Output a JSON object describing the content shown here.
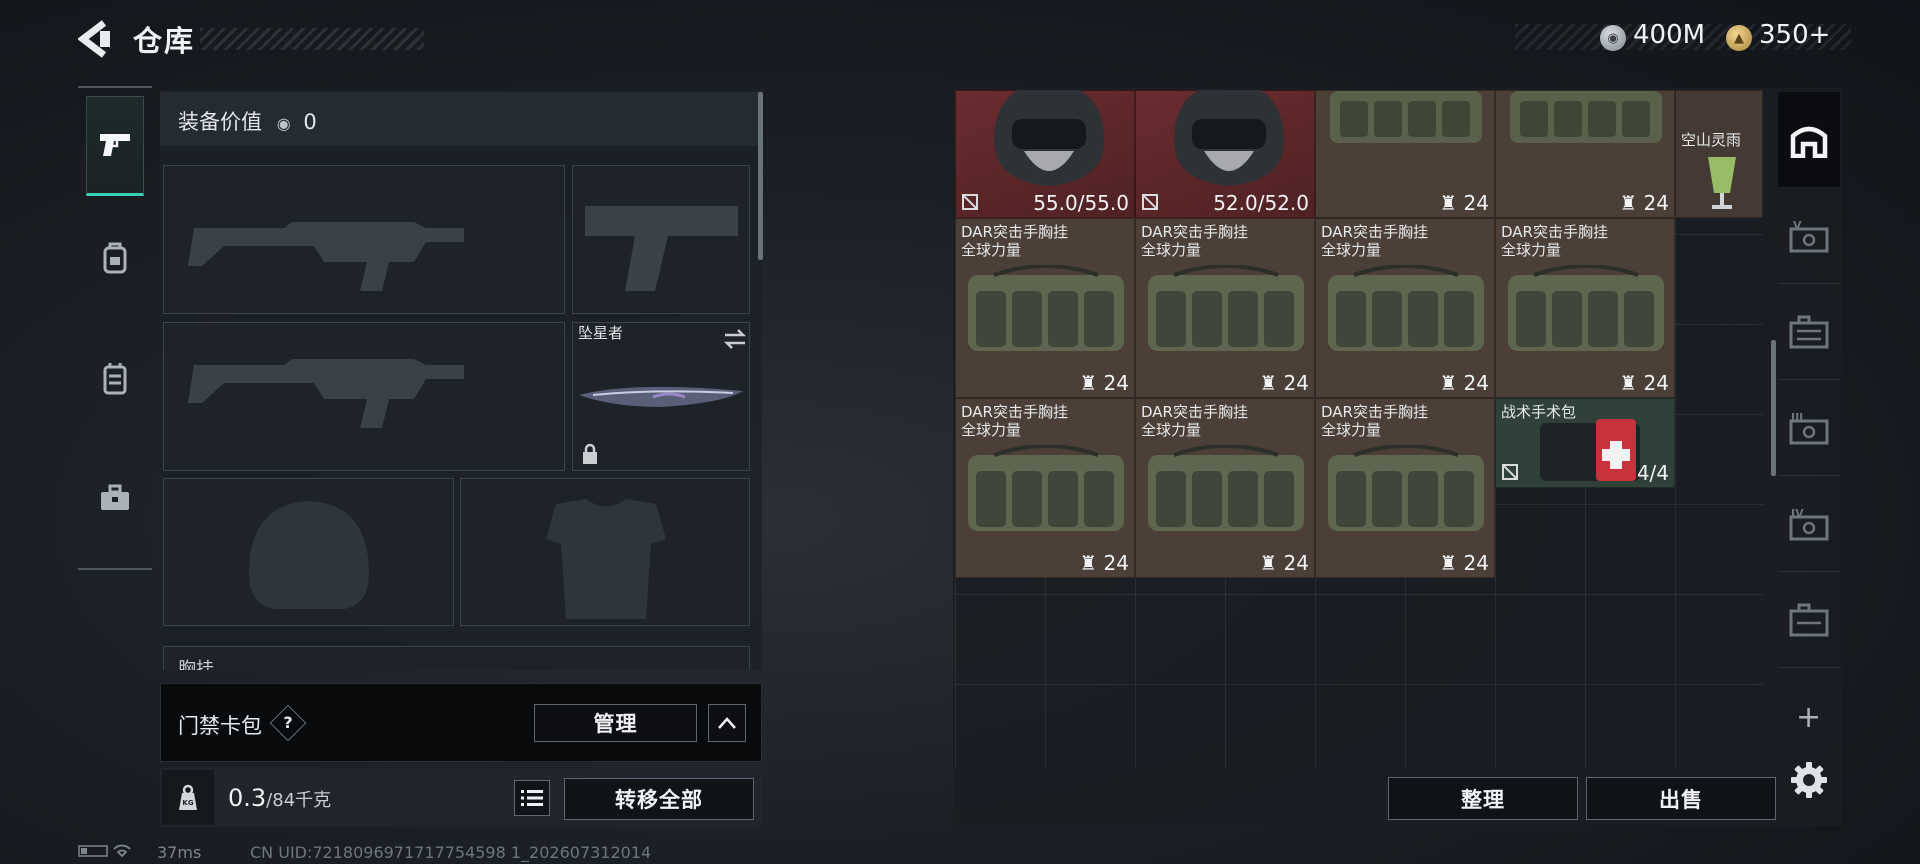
{
  "header": {
    "title": "仓库",
    "currency1": "400M",
    "currency2": "350+"
  },
  "left_tabs": [
    {
      "icon": "pistol-icon",
      "active": true
    },
    {
      "icon": "backpack-icon"
    },
    {
      "icon": "chest-rig-icon"
    },
    {
      "icon": "toolbox-icon"
    }
  ],
  "equipment": {
    "value_label": "装备价值",
    "value": "0",
    "knife_name": "坠星者",
    "partial_label": "胸挂",
    "keycard_label": "门禁卡包",
    "help": "?",
    "manage_label": "管理"
  },
  "weight": {
    "current": "0.3",
    "max": "/84千克",
    "transfer_label": "转移全部"
  },
  "status": {
    "ping": "37ms",
    "uid": "CN UID:7218096971717754598 1_202607312014"
  },
  "stash": {
    "row0": [
      {
        "name": "",
        "stat": "55.0/55.0",
        "type": "helmet",
        "durability": true
      },
      {
        "name": "",
        "stat": "52.0/52.0",
        "type": "helmet",
        "durability": true
      },
      {
        "name": "",
        "stat": "24",
        "type": "rig"
      },
      {
        "name": "",
        "stat": "24",
        "type": "rig"
      },
      {
        "name": "空山灵雨",
        "stat": "",
        "type": "drink"
      }
    ],
    "rig_name_line1": "DAR突击手胸挂",
    "rig_name_line2": "全球力量",
    "rig_count": "24",
    "medkit_name": "战术手术包",
    "medkit_stat": "4/4"
  },
  "buttons": {
    "sort": "整理",
    "sell": "出售",
    "plus": "+"
  },
  "right_tabs": [
    {
      "icon": "home-icon",
      "active": true
    },
    {
      "icon": "tier-5-storage-icon",
      "label": "V"
    },
    {
      "icon": "storage-box-icon"
    },
    {
      "icon": "tier-3-storage-icon",
      "label": "III"
    },
    {
      "icon": "tier-4-storage-icon",
      "label": "IV"
    },
    {
      "icon": "storage-crate-icon"
    }
  ]
}
